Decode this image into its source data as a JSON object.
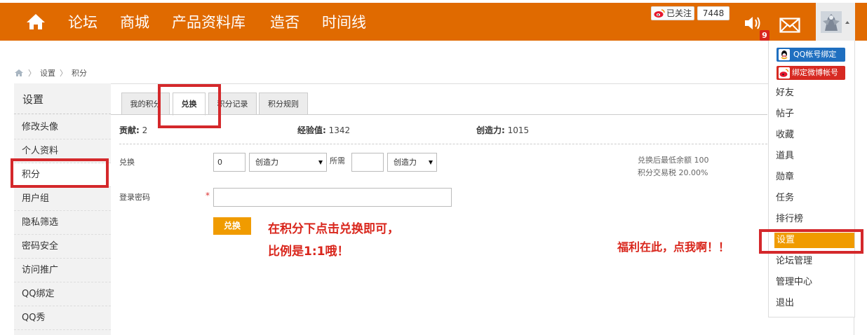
{
  "topbar": {
    "nav": [
      "论坛",
      "商城",
      "产品资料库",
      "造否",
      "时间线"
    ],
    "follow_label": "已关注",
    "follow_count": "7448",
    "notification_count": "9",
    "icons": [
      "home-icon",
      "weibo-icon",
      "sound-icon",
      "mail-icon",
      "avatar"
    ]
  },
  "breadcrumb": [
    "设置",
    "积分"
  ],
  "sidebar": {
    "title": "设置",
    "items": [
      "修改头像",
      "个人资料",
      "积分",
      "用户组",
      "隐私筛选",
      "密码安全",
      "访问推广",
      "QQ绑定",
      "QQ秀"
    ],
    "active": "积分"
  },
  "tabs": [
    "我的积分",
    "兑换",
    "积分记录",
    "积分规则"
  ],
  "active_tab": "兑换",
  "stats": [
    {
      "label": "贡献:",
      "value": "2"
    },
    {
      "label": "经验值:",
      "value": "1342"
    },
    {
      "label": "创造力:",
      "value": "1015"
    }
  ],
  "exchange": {
    "label": "兑换",
    "amount": "0",
    "from_currency": "创造力",
    "needed_label": "所需",
    "needed_value": "",
    "to_currency": "创造力",
    "note_min": "兑换后最低余额 100",
    "note_tax": "积分交易税 20.00%"
  },
  "password": {
    "label": "登录密码",
    "required_mark": "*",
    "value": ""
  },
  "submit_label": "兑换",
  "annotations": {
    "line1": "在积分下点击兑换即可，",
    "line2": "比例是1:1哦！",
    "dropdown_hint": "福利在此，点我啊！！"
  },
  "dropdown": {
    "qq_bind": "QQ帐号绑定",
    "weibo_bind": "绑定微博帐号",
    "items": [
      "好友",
      "帖子",
      "收藏",
      "道具",
      "勋章",
      "任务",
      "排行榜",
      "设置",
      "论坛管理",
      "管理中心",
      "退出"
    ],
    "active": "设置"
  },
  "colors": {
    "topbar": "#e06a00",
    "accent": "#f09b00",
    "highlight": "#d4282b",
    "qq_blue": "#1f6fc0",
    "weibo_red": "#d72a22"
  }
}
